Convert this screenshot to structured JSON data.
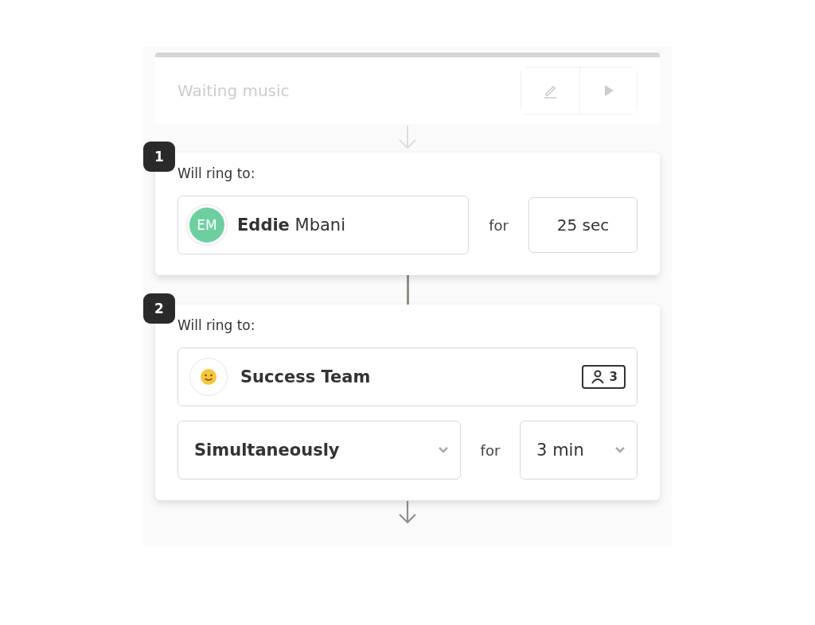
{
  "waiting_music": {
    "label": "Waiting music"
  },
  "steps": [
    {
      "number": "1",
      "heading": "Will ring to:",
      "target": {
        "kind": "person",
        "initials": "EM",
        "name": "**Eddie** Mbani"
      },
      "for_label": "for",
      "duration": {
        "kind": "fixed",
        "value": "25 sec"
      }
    },
    {
      "number": "2",
      "heading": "Will ring to:",
      "target": {
        "kind": "team",
        "name": "Success Team",
        "member_count": "3"
      },
      "strategy": {
        "value": "Simultaneously"
      },
      "for_label": "for",
      "duration": {
        "kind": "dropdown",
        "value": "3 min"
      }
    }
  ]
}
